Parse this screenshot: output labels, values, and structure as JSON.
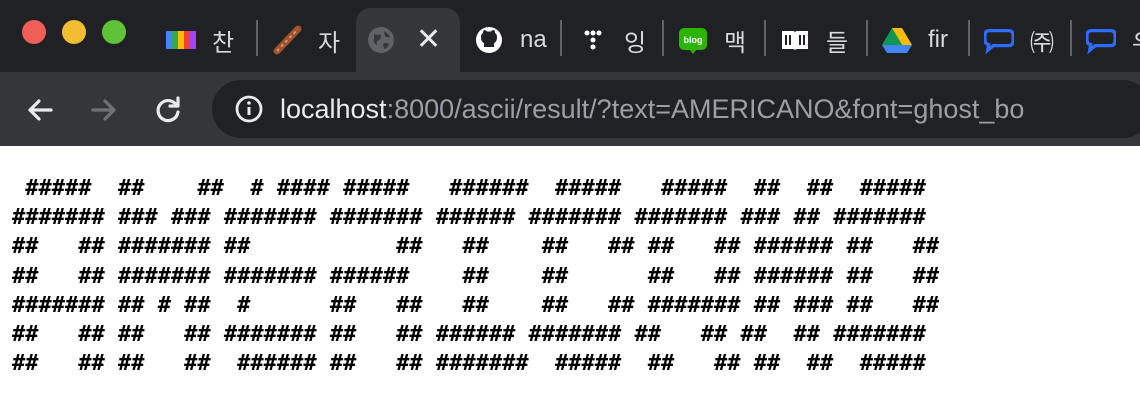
{
  "tabs": [
    {
      "title": "찬",
      "icon": "colorful-bar-icon"
    },
    {
      "title": "자",
      "icon": "brush-icon"
    },
    {
      "title": "",
      "icon": "globe-icon",
      "active": true
    },
    {
      "title": "na",
      "icon": "github-icon"
    },
    {
      "title": "잉",
      "icon": "dots-icon"
    },
    {
      "title": "맥",
      "icon": "blog-icon"
    },
    {
      "title": "들",
      "icon": "book-icon"
    },
    {
      "title": "fir",
      "icon": "google-drive-icon"
    },
    {
      "title": "㈜",
      "icon": "chat-bubble-icon"
    },
    {
      "title": "우",
      "icon": "chat-bubble-icon"
    }
  ],
  "active_tab_close": "✕",
  "address_bar": {
    "host": "localhost",
    "rest": ":8000/ascii/result/?text=AMERICANO&font=ghost_bo"
  },
  "ascii_art": " #####  ##    ##  # #### #####   ######  #####   #####  ##  ##  #####\n####### ### ### ####### ####### ###### ####### ####### ### ## #######\n##   ## ####### ##           ##   ##    ##   ## ##   ## ###### ##   ##\n##   ## ####### ####### ######    ##    ##      ##   ## ###### ##   ##\n####### ## # ##  #      ##   ##   ##    ##   ## ####### ## ### ##   ##\n##   ## ##   ## ####### ##   ## ###### ####### ##   ## ##  ## #######\n##   ## ##   ##  ###### ##   ## #######  #####  ##   ## ##  ##  #####",
  "colors": {
    "tabstrip": "#202124",
    "toolbar": "#35363a",
    "omnibox": "#202124"
  }
}
